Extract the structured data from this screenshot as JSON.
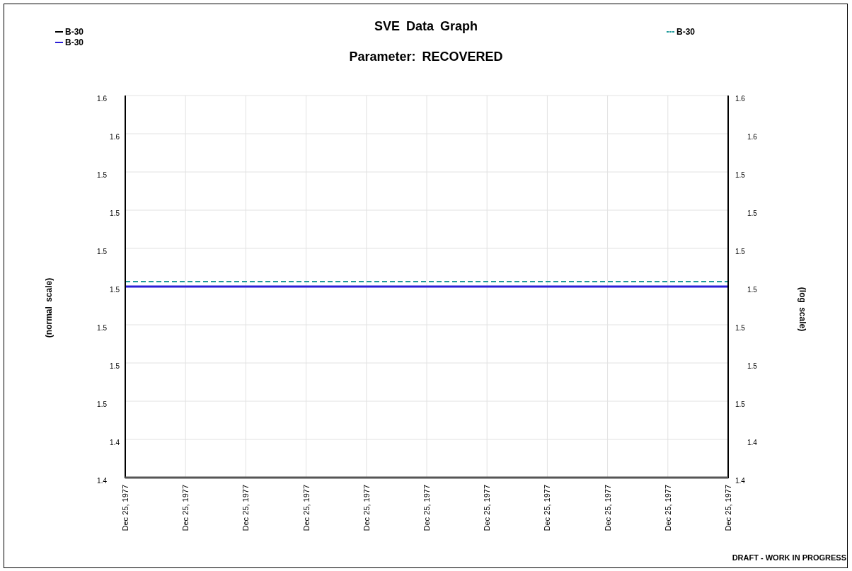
{
  "title": "SVE Data Graph",
  "subtitle": "Parameter: RECOVERED",
  "legend_left": [
    {
      "label": "B-30",
      "color": "#000000",
      "kind": "solid"
    },
    {
      "label": "B-30",
      "color": "#2b1fd6",
      "kind": "solid"
    }
  ],
  "legend_right": [
    {
      "label": "B-30",
      "color": "#1f9a9a",
      "kind": "dashed"
    }
  ],
  "left_axis": {
    "title": "(normal scale)",
    "ticks": [
      "1.6",
      "1.6",
      "1.5",
      "1.5",
      "1.5",
      "1.5",
      "1.5",
      "1.5",
      "1.5",
      "1.4",
      "1.4"
    ]
  },
  "right_axis": {
    "title": "(log scale)",
    "ticks": [
      "1.6",
      "1.6",
      "1.5",
      "1.5",
      "1.5",
      "1.5",
      "1.5",
      "1.5",
      "1.5",
      "1.4",
      "1.4"
    ]
  },
  "x_ticks": [
    "Dec 25, 1977",
    "Dec 25, 1977",
    "Dec 25, 1977",
    "Dec 25, 1977",
    "Dec 25, 1977",
    "Dec 25, 1977",
    "Dec 25, 1977",
    "Dec 25, 1977",
    "Dec 25, 1977",
    "Dec 25, 1977",
    "Dec 25, 1977"
  ],
  "footer": "DRAFT - WORK IN PROGRESS"
}
